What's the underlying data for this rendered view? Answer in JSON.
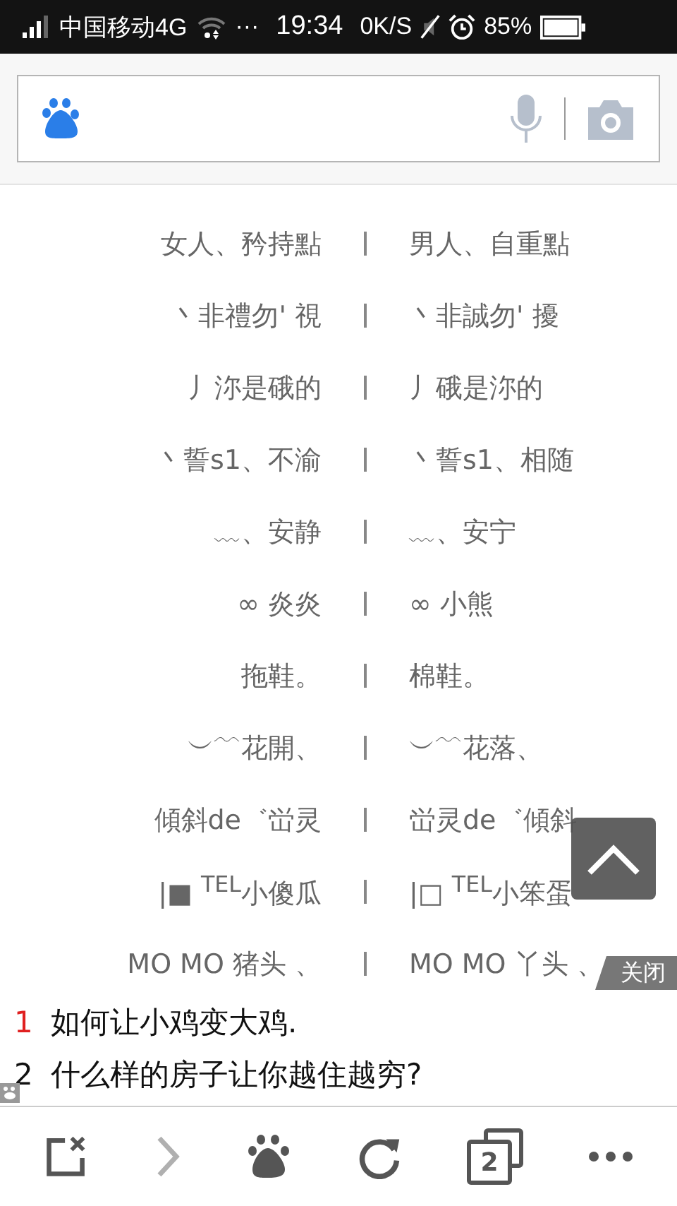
{
  "status_bar": {
    "carrier": "中国移动4G",
    "dots": "···",
    "time": "19:34",
    "speed": "0K/S",
    "battery": "85%"
  },
  "rows": [
    {
      "left": "女人、矜持點",
      "right": "男人、自重點"
    },
    {
      "left": "丶非禮勿'  視",
      "right": "丶非誠勿'  擾"
    },
    {
      "left": "丿沵是硪的",
      "right": "丿硪是沵的"
    },
    {
      "left": "丶誓s1、不渝",
      "right": "丶誓s1、相随"
    },
    {
      "left": "﹏、安静",
      "right": "﹏、安宁"
    },
    {
      "left": "∞ 炎炎",
      "right": "∞ 小熊"
    },
    {
      "left": "拖鞋。",
      "right": "棉鞋。"
    },
    {
      "left": "︶﹋花開、",
      "right": "︶﹋花落、"
    },
    {
      "left": "傾斜de゛峃灵",
      "right": "峃灵de゛傾斜"
    },
    {
      "left": "|■ $^{TEL}$小傻瓜",
      "right": "|□ $^{TEL}$小笨蛋"
    },
    {
      "left": "MO MO 猪头 、",
      "right": "MO MO 丫头 、"
    }
  ],
  "hot_search": {
    "close_label": "关闭",
    "items": [
      {
        "rank": "1",
        "text": "如何让小鸡变大鸡.",
        "color": "#e02020"
      },
      {
        "rank": "2",
        "text": "什么样的房子让你越住越穷?",
        "color": "#111111"
      }
    ]
  },
  "bottom_bar": {
    "tab_count": "2",
    "forward_disabled": true
  }
}
